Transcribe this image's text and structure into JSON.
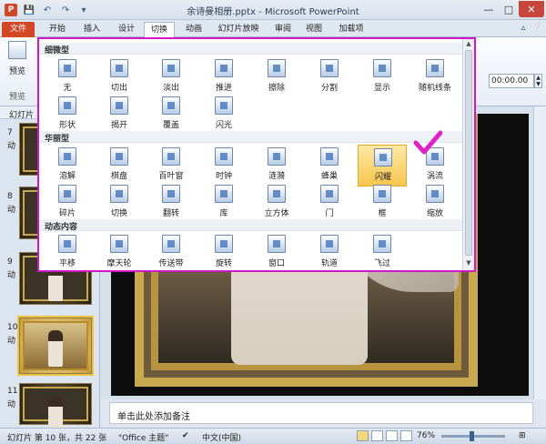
{
  "titlebar": {
    "app_icon": "P",
    "title": "余诗曼相册.pptx - Microsoft PowerPoint",
    "qat_icons": [
      "save-icon",
      "undo-icon",
      "redo-icon",
      "customize-icon"
    ],
    "controls": [
      "minimize-icon",
      "maximize-icon",
      "close-icon"
    ]
  },
  "tabs": {
    "file": "文件",
    "items": [
      "开始",
      "插入",
      "设计",
      "切换",
      "动画",
      "幻灯片放映",
      "审阅",
      "视图",
      "加载项"
    ],
    "active": "切换"
  },
  "ribbon": {
    "preview_label": "预览",
    "group_label": "预览",
    "duration_label": "",
    "duration_value": "00:00.00"
  },
  "gallery": {
    "sections": [
      {
        "title": "细微型",
        "items": [
          "无",
          "切出",
          "淡出",
          "推进",
          "擦除",
          "分割",
          "显示",
          "随机线条",
          "形状",
          "揭开",
          "覆盖",
          "闪光"
        ]
      },
      {
        "title": "华丽型",
        "items": [
          "溶解",
          "棋盘",
          "百叶窗",
          "时钟",
          "涟漪",
          "蜂巢",
          "闪耀",
          "涡流",
          "碎片",
          "切换",
          "翻转",
          "库",
          "立方体",
          "门",
          "框",
          "缩放"
        ]
      },
      {
        "title": "动态内容",
        "items": [
          "平移",
          "摩天轮",
          "传送带",
          "旋转",
          "窗口",
          "轨道",
          "飞过"
        ]
      }
    ],
    "selected": "闪耀"
  },
  "slide_pane": {
    "header": "幻灯片",
    "thumbs": [
      {
        "num": "7",
        "extra": "动"
      },
      {
        "num": "8",
        "extra": "动"
      },
      {
        "num": "9",
        "extra": "动"
      },
      {
        "num": "10",
        "extra": "动"
      },
      {
        "num": "11",
        "extra": "动"
      }
    ],
    "selected_index": 3
  },
  "notes": {
    "placeholder": "单击此处添加备注"
  },
  "status": {
    "slide_info": "幻灯片 第 10 张，共 22 张",
    "theme": "\"Office 主题\"",
    "language": "中文(中国)",
    "zoom": "76%"
  },
  "colors": {
    "accent": "#d24726",
    "highlight_border": "#d018c8",
    "selection": "#f7c54e"
  }
}
